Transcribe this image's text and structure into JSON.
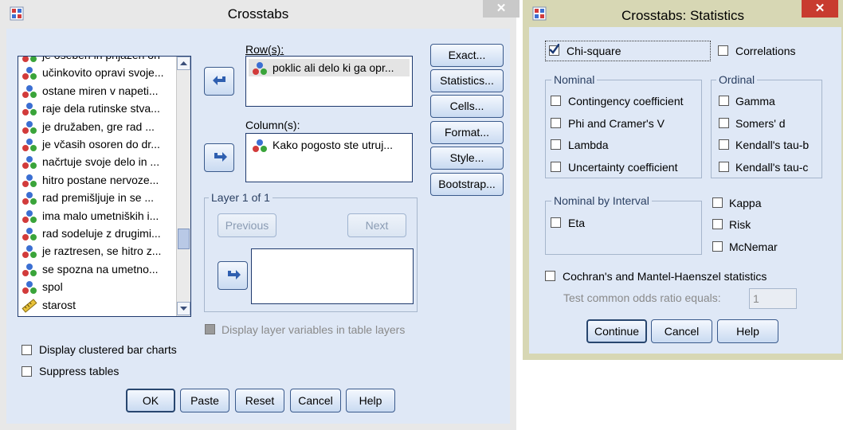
{
  "left_window": {
    "title": "Crosstabs",
    "close_glyph": "✕",
    "variables": [
      {
        "label": "je oseben in prijazen on",
        "icon": "nominal-icon"
      },
      {
        "label": "učinkovito opravi svoje...",
        "icon": "nominal-icon"
      },
      {
        "label": "ostane miren v napeti...",
        "icon": "nominal-icon"
      },
      {
        "label": "raje dela rutinske stva...",
        "icon": "nominal-icon"
      },
      {
        "label": "je družaben, gre rad ...",
        "icon": "nominal-icon"
      },
      {
        "label": "je včasih osoren do dr...",
        "icon": "nominal-icon"
      },
      {
        "label": "načrtuje svoje delo in ...",
        "icon": "nominal-icon"
      },
      {
        "label": "hitro postane nervoze...",
        "icon": "nominal-icon"
      },
      {
        "label": "rad premišljuje in se ...",
        "icon": "nominal-icon"
      },
      {
        "label": "ima malo umetniških i...",
        "icon": "nominal-icon"
      },
      {
        "label": "rad sodeluje z drugimi...",
        "icon": "nominal-icon"
      },
      {
        "label": "je raztresen, se hitro z...",
        "icon": "nominal-icon"
      },
      {
        "label": "se spozna na umetno...",
        "icon": "nominal-icon"
      },
      {
        "label": "spol",
        "icon": "nominal-icon"
      },
      {
        "label": "starost",
        "icon": "scale-icon"
      }
    ],
    "rows_label": "Row(s):",
    "rows": [
      {
        "label": "poklic ali delo ki ga opr..."
      }
    ],
    "columns_label": "Column(s):",
    "columns": [
      {
        "label": "Kako pogosto ste utruj..."
      }
    ],
    "layer_label": "Layer 1 of 1",
    "previous_label": "Previous",
    "next_label": "Next",
    "display_layer_label": "Display layer variables in table layers",
    "clustered_bar_label": "Display clustered bar charts",
    "suppress_tables_label": "Suppress tables",
    "side_buttons": [
      "Exact...",
      "Statistics...",
      "Cells...",
      "Format...",
      "Style...",
      "Bootstrap..."
    ],
    "bottom_buttons": [
      "OK",
      "Paste",
      "Reset",
      "Cancel",
      "Help"
    ]
  },
  "right_window": {
    "title": "Crosstabs: Statistics",
    "close_glyph": "✕",
    "chi_square_label": "Chi-square",
    "chi_square_checked": true,
    "correlations_label": "Correlations",
    "nominal_title": "Nominal",
    "nominal_items": [
      "Contingency coefficient",
      "Phi and Cramer's V",
      "Lambda",
      "Uncertainty coefficient"
    ],
    "ordinal_title": "Ordinal",
    "ordinal_items": [
      "Gamma",
      "Somers' d",
      "Kendall's tau-b",
      "Kendall's tau-c"
    ],
    "nominal_interval_title": "Nominal by Interval",
    "eta_label": "Eta",
    "kappa_label": "Kappa",
    "risk_label": "Risk",
    "mcnemar_label": "McNemar",
    "cochran_label": "Cochran's and Mantel-Haenszel statistics",
    "odds_ratio_label": "Test common odds ratio equals:",
    "odds_ratio_value": "1",
    "continue_label": "Continue",
    "cancel_label": "Cancel",
    "help_label": "Help"
  },
  "colors": {
    "client_bg": "#dfe8f6",
    "frame_bg": "#e8e8e8",
    "accent_blue": "#2f5fb0",
    "selection": "#e4e4e4"
  }
}
